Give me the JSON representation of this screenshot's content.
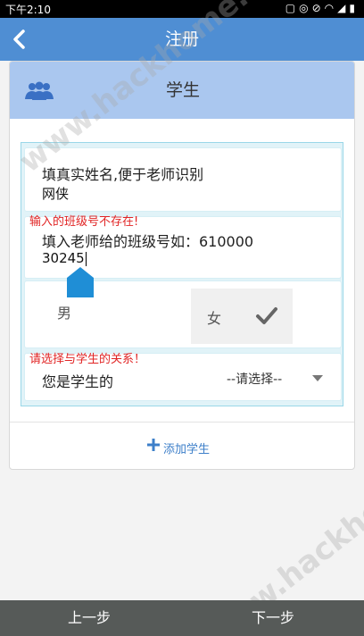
{
  "status_bar": {
    "time": "下午2:10",
    "icons": [
      "notification-icon",
      "circle-icon",
      "silent-icon",
      "wifi-icon",
      "signal-icon",
      "battery-icon"
    ]
  },
  "app_bar": {
    "title": "注册"
  },
  "card": {
    "header_title": "学生",
    "name_field": {
      "hint": "填真实姓名,便于老师识别",
      "value": "网侠"
    },
    "class_field": {
      "error": "输入的班级号不存在!",
      "hint": "填入老师给的班级号如：610000",
      "value": "30245"
    },
    "gender": {
      "male": "男",
      "female": "女",
      "selected": "女"
    },
    "relation": {
      "error": "请选择与学生的关系！",
      "label": "您是学生的",
      "select_value": "--请选择--"
    },
    "add_student": "添加学生"
  },
  "bottom_bar": {
    "prev": "上一步",
    "next": "下一步"
  },
  "watermark": "www.hackhome.com",
  "colors": {
    "app_bar": "#4f8ed3",
    "card_header": "#aac7ef",
    "error": "#e12424",
    "accent": "#3d7fc9",
    "bottom_bar": "#565a58"
  }
}
